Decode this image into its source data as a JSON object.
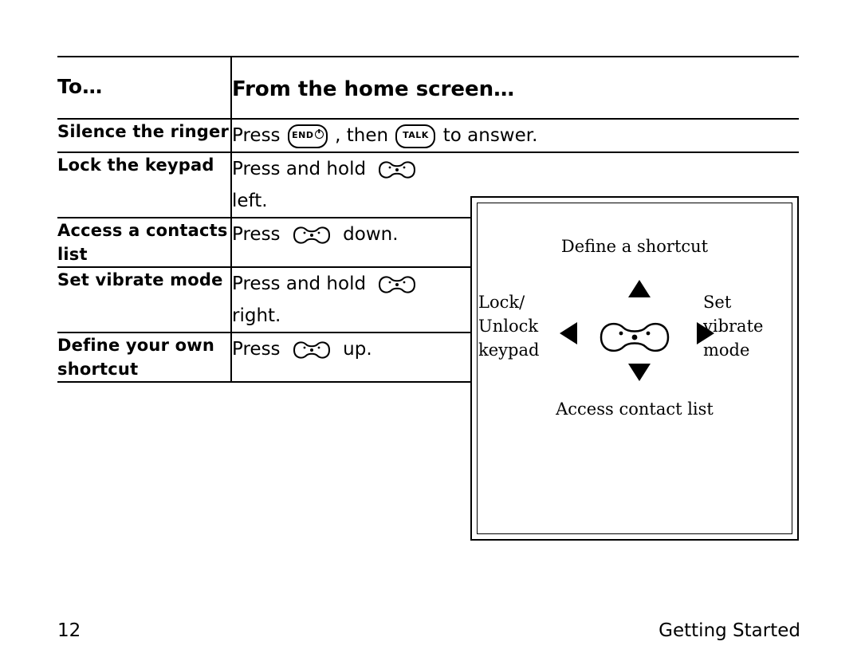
{
  "document": {
    "table": {
      "header": {
        "col1": "To…",
        "col2": "From the home screen…"
      },
      "rows": [
        {
          "label": "Silence the ringer",
          "text_before": "Press",
          "icon1": "end-key-icon",
          "text_mid": ", then",
          "icon2": "talk-key-icon",
          "text_after": "to answer."
        },
        {
          "label": "Lock the keypad",
          "text_before": "Press and hold",
          "icon1": "navigation-key-icon",
          "text_after": "left."
        },
        {
          "label": "Access a contacts list",
          "text_before": "Press",
          "icon1": "navigation-key-icon",
          "text_after": "down."
        },
        {
          "label": "Set vibrate mode",
          "text_before": "Press and hold",
          "icon1": "navigation-key-icon",
          "text_after": "right."
        },
        {
          "label": "Define your own shortcut",
          "text_before": "Press",
          "icon1": "navigation-key-icon",
          "text_after": "up."
        }
      ]
    },
    "diagram": {
      "top_label": "Define a shortcut",
      "bottom_label": "Access contact list",
      "left_label": "Lock/\nUnlock\nkeypad",
      "left_label_line1": "Lock/",
      "left_label_line2": "Unlock",
      "left_label_line3": "keypad",
      "right_label_line1": "Set",
      "right_label_line2": "vibrate",
      "right_label_line3": "mode",
      "center_icon": "navigation-key-icon"
    },
    "footer": {
      "page_number": "12",
      "section": "Getting Started"
    },
    "keys": {
      "end_label": "END",
      "talk_label": "TALK"
    }
  }
}
